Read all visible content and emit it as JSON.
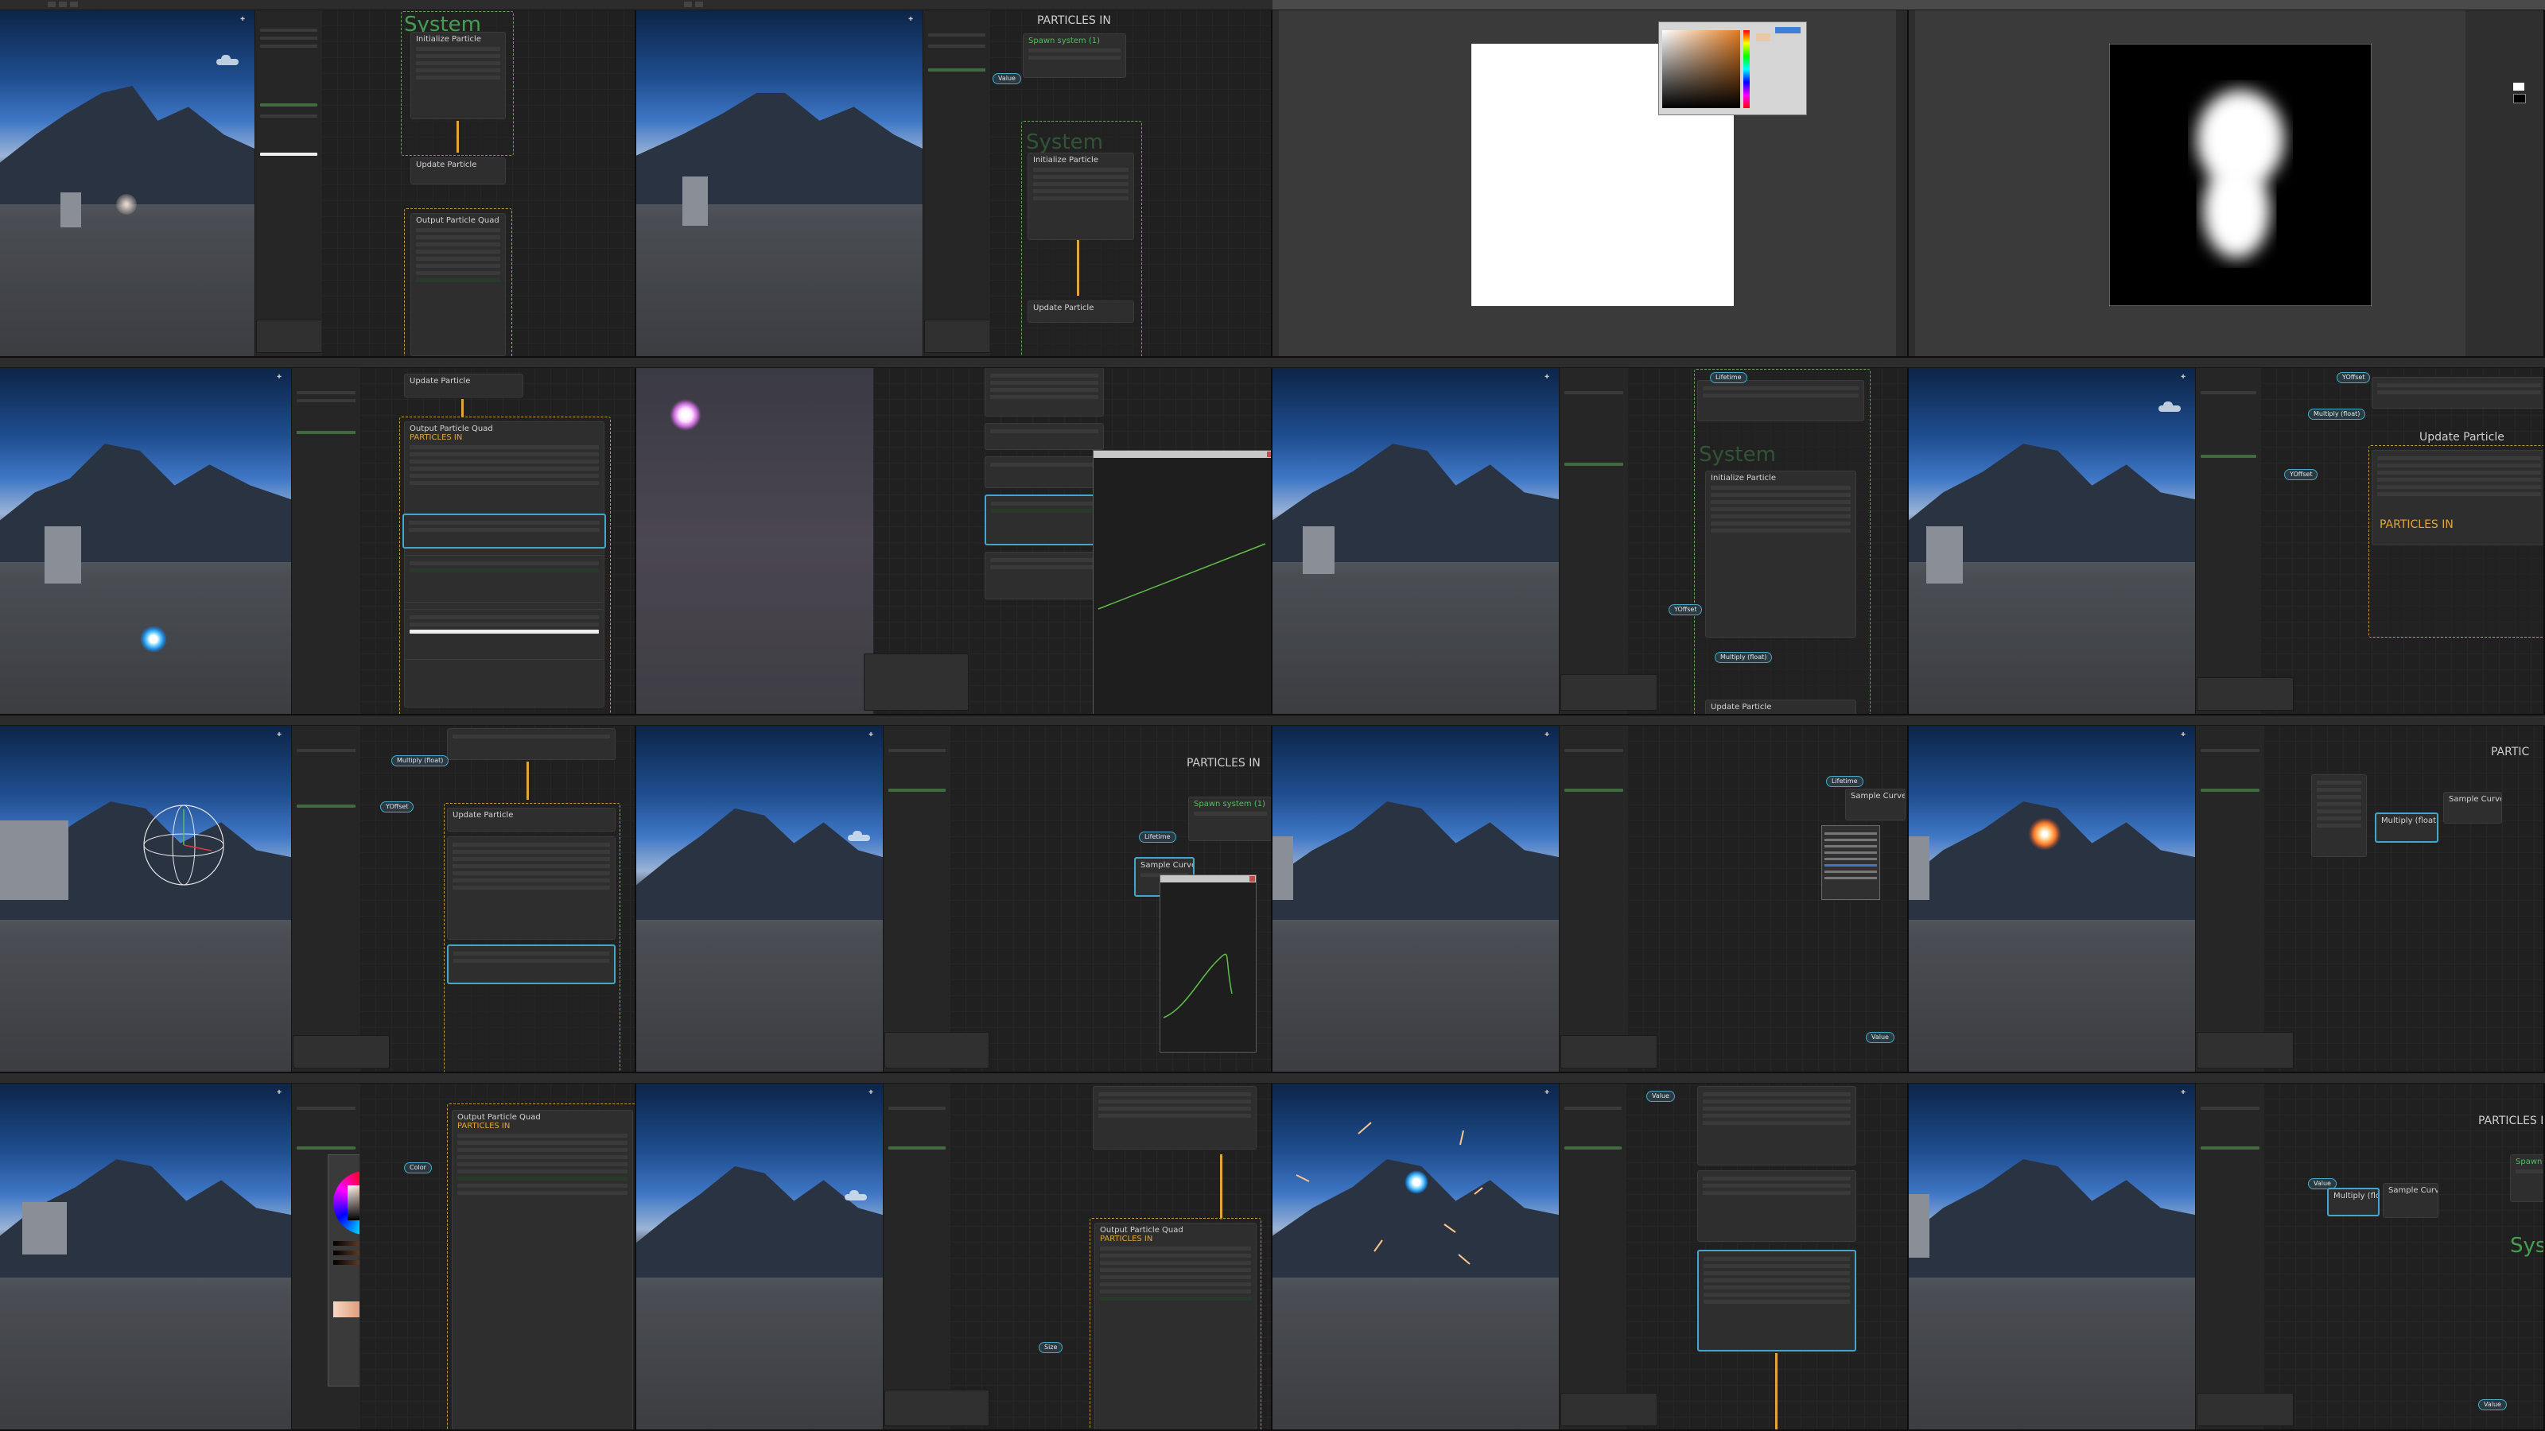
{
  "labels": {
    "system": "System",
    "update_particle": "Update Particle",
    "initialize_particle": "Initialize Particle",
    "output_particle_quad": "Output Particle Quad",
    "particles_in": "PARTICLES IN",
    "spawn_system": "Spawn system (1)",
    "partic": "PARTIC",
    "system_short": "Syste"
  },
  "nodes": {
    "multiply_float": "Multiply (float)",
    "sample_curve": "Sample Curve",
    "yoffset": "YOffset"
  },
  "colors": {
    "context_green": "#6aa35d",
    "context_yellow": "#c29c3a",
    "selection_blue": "#43a7c9",
    "flow_orange": "#e0a63a",
    "sky_top": "#0c2447",
    "sky_bottom": "#3f77c6"
  },
  "icons": [
    "scene-gizmo-icon",
    "color-picker-icon",
    "color-wheel-icon",
    "particle-glow-icon"
  ]
}
